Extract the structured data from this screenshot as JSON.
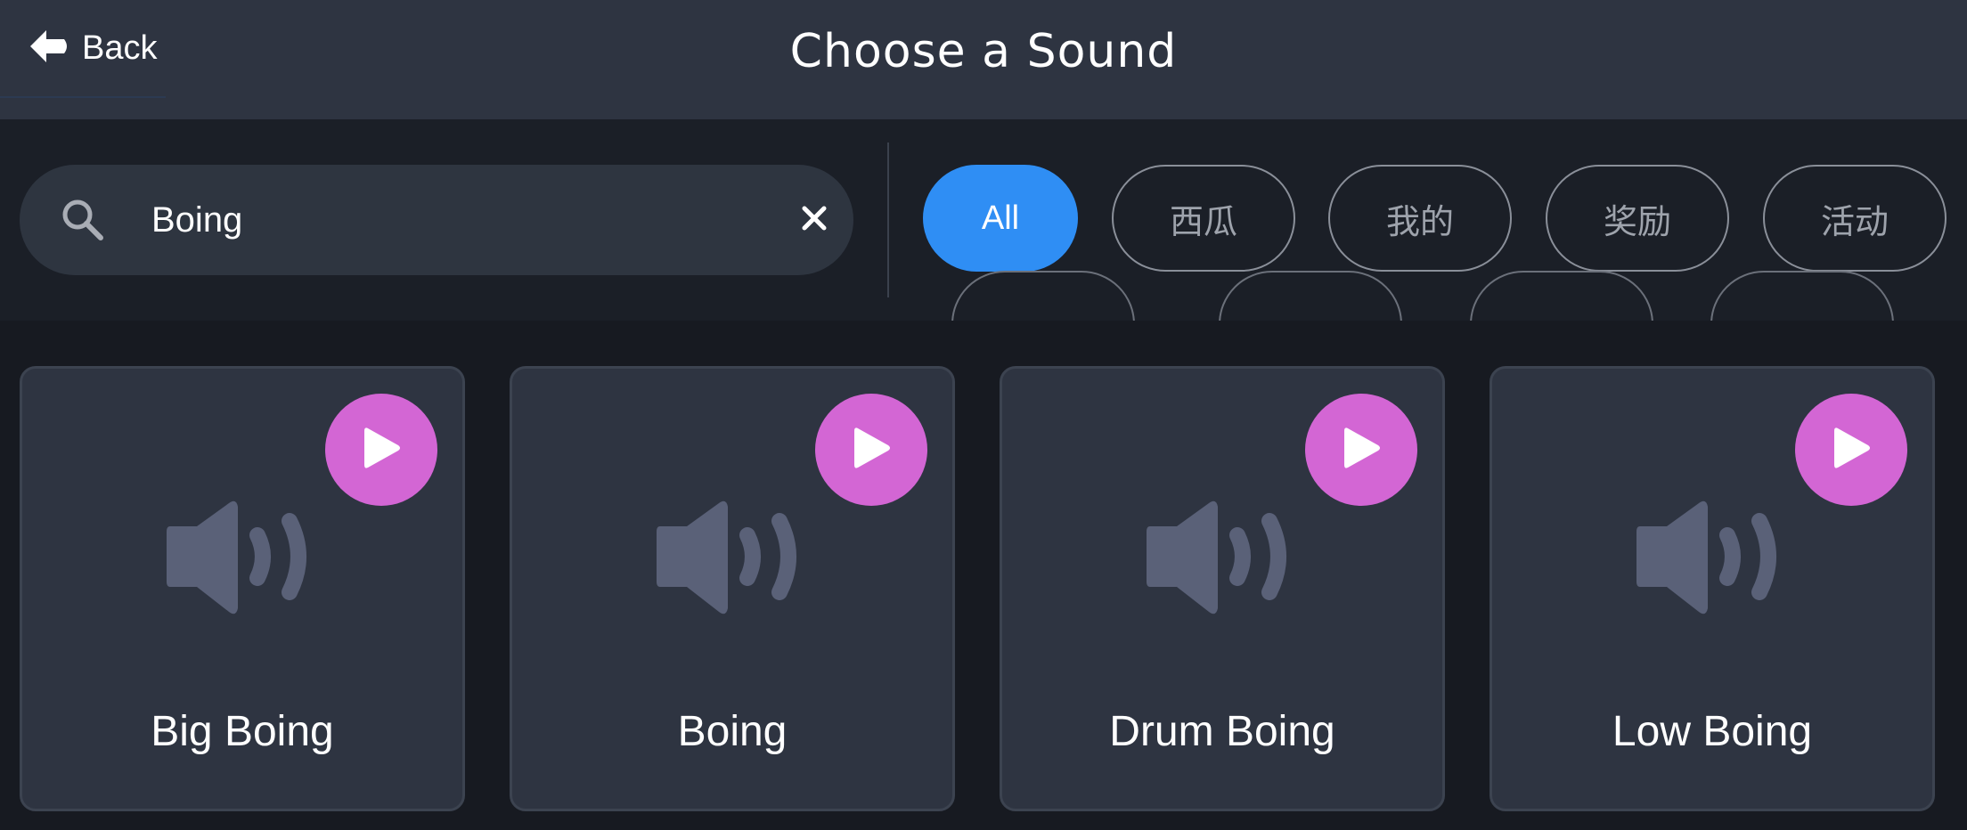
{
  "header": {
    "back_label": "Back",
    "title": "Choose a Sound"
  },
  "search": {
    "value": "Boing",
    "icon": "search-icon",
    "clear_icon": "close-icon"
  },
  "filters": [
    {
      "label": "All",
      "active": true
    },
    {
      "label": "西瓜",
      "active": false
    },
    {
      "label": "我的",
      "active": false
    },
    {
      "label": "奖励",
      "active": false
    },
    {
      "label": "活动",
      "active": false
    }
  ],
  "sounds": [
    {
      "name": "Big Boing"
    },
    {
      "name": "Boing"
    },
    {
      "name": "Drum Boing"
    },
    {
      "name": "Low Boing"
    }
  ],
  "colors": {
    "accent": "#2f8ef4",
    "play": "#d366d4",
    "speaker": "#5a6178"
  }
}
